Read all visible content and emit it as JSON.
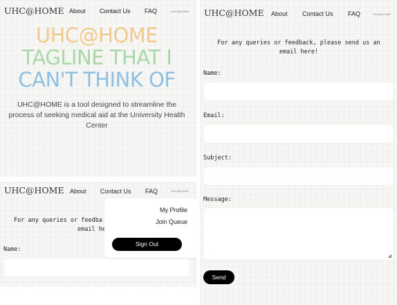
{
  "nav": {
    "brand": "UHC@HOME",
    "about": "About",
    "contact": "Contact Us",
    "faq": "FAQ",
    "mini_logo": "UHC@HOME"
  },
  "hero": {
    "title_line1": "UHC@HOME",
    "title_line2": "TAGLINE THAT I",
    "title_line3": "CAN'T THINK OF",
    "description": "UHC@HOME is a tool designed to streamline the process of seeking medical aid at the University Health Center",
    "colors": {
      "line1": "#f2c98c",
      "line2": "#a8d8a6",
      "line3": "#8fbfe0"
    }
  },
  "contact": {
    "intro": "For any queries or feedback, please send us an email here!",
    "intro_truncated_line1": "For any queries or feedba",
    "intro_truncated_line2": "email he",
    "name_label": "Name:",
    "email_label": "Email:",
    "subject_label": "Subject:",
    "message_label": "Message:",
    "send_label": "Send"
  },
  "menu": {
    "my_profile": "My Profile",
    "join_queue": "Join Queue",
    "sign_out": "Sign Out"
  }
}
